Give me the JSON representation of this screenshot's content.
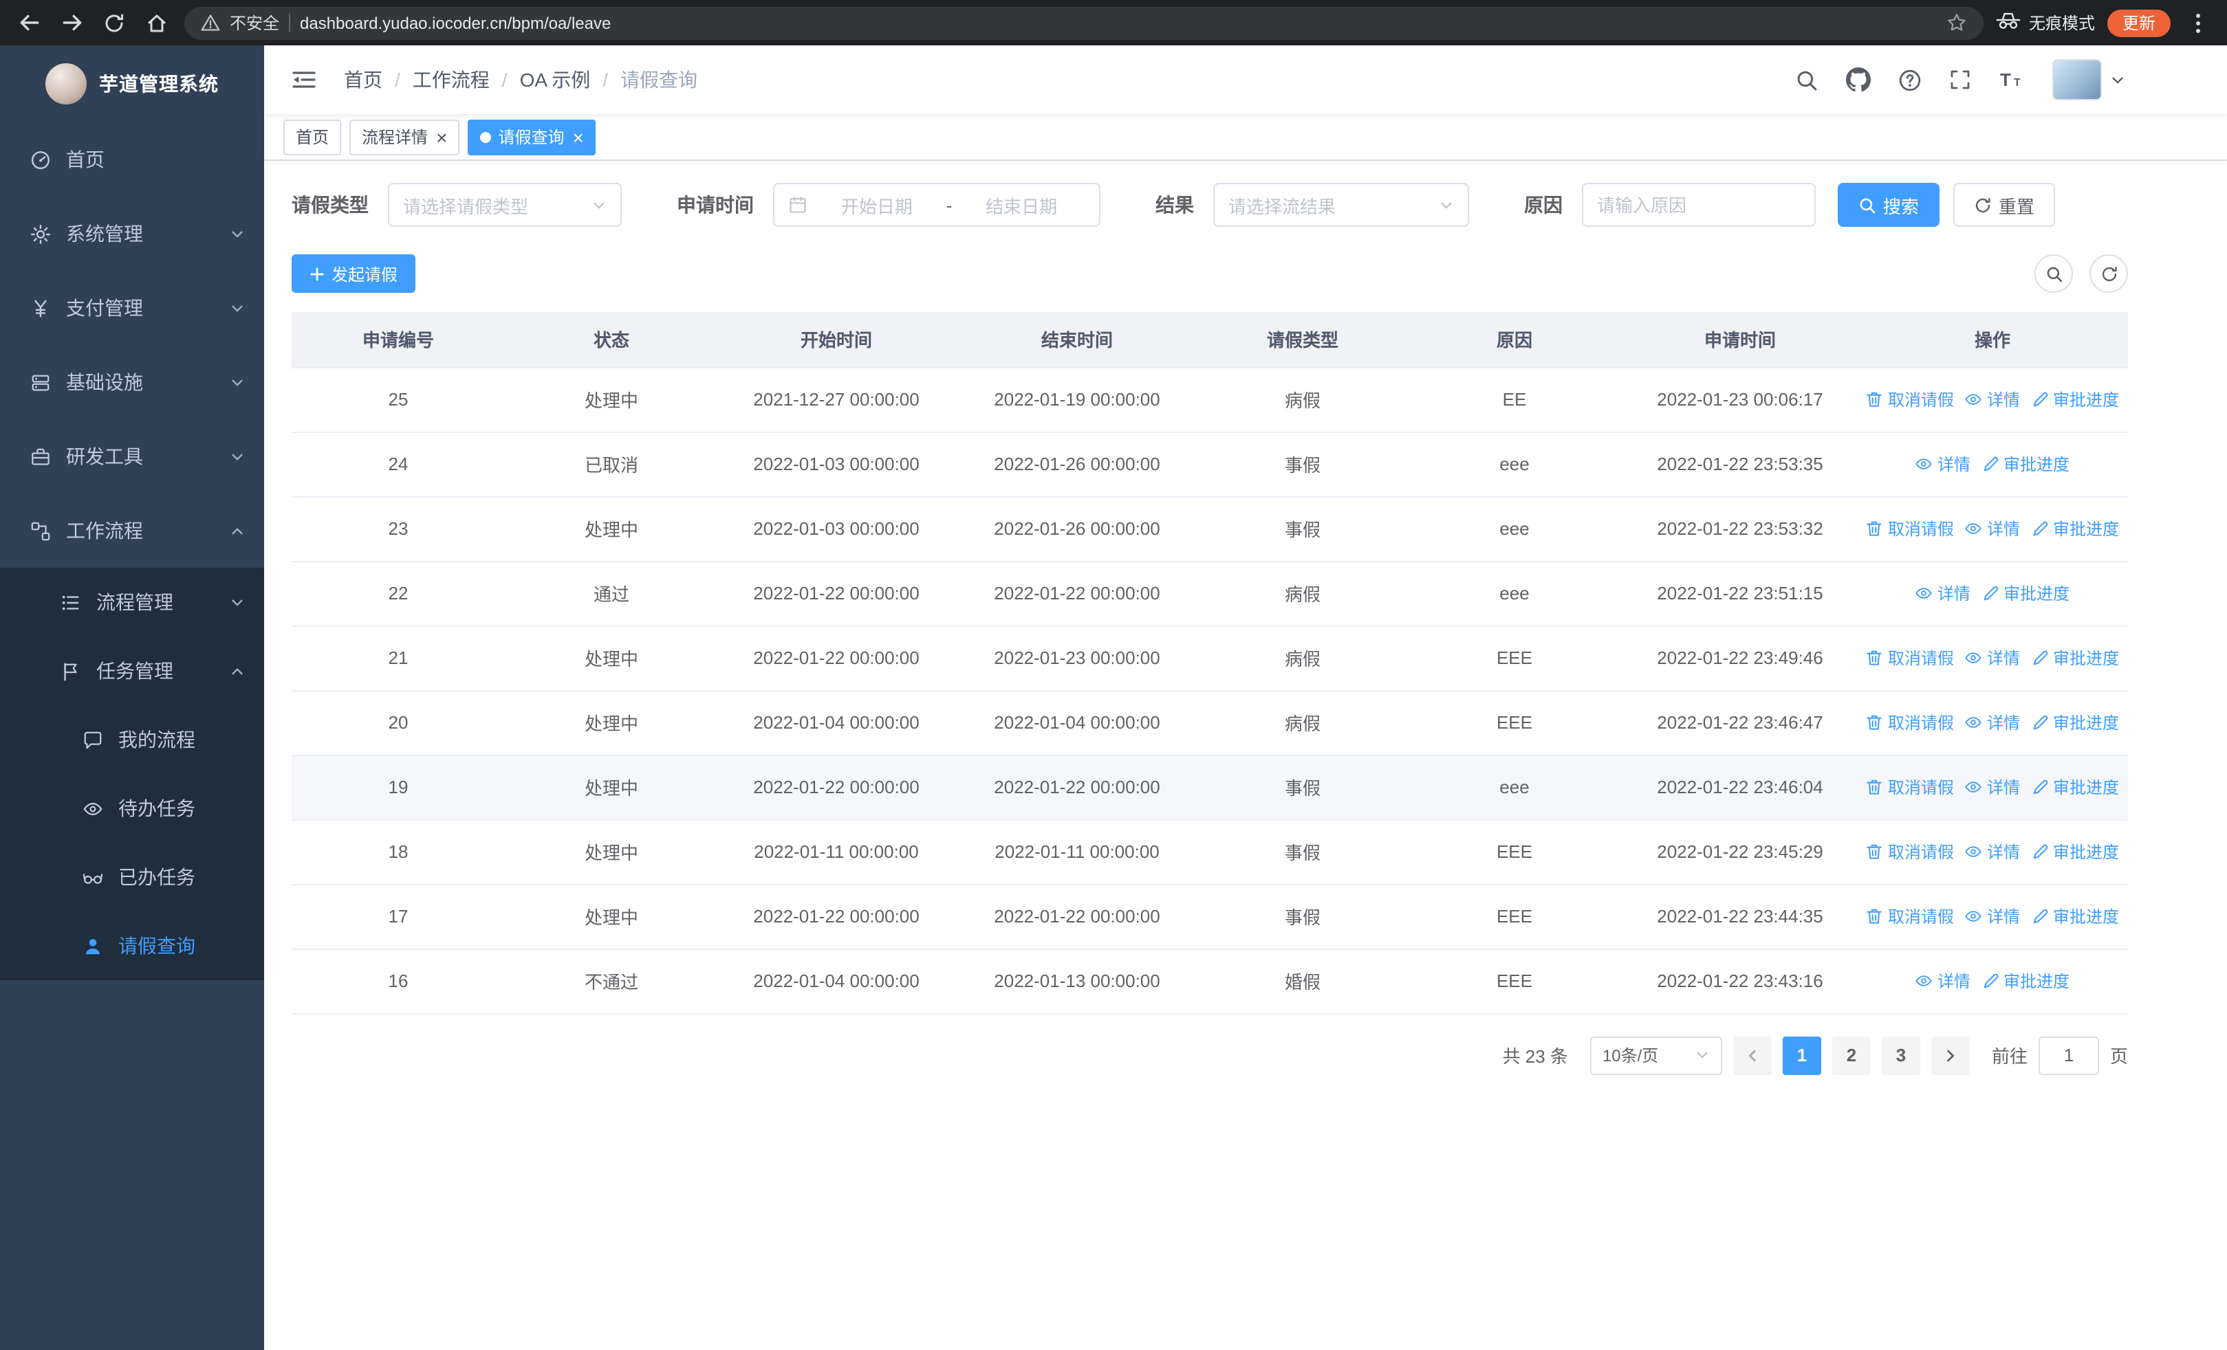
{
  "colors": {
    "primary": "#409eff",
    "sidebar_bg": "#304156",
    "sidebar_submenu_bg": "#1f2d3d",
    "active_tab_bg": "#409eff",
    "update_button_bg": "#ed6337"
  },
  "browser": {
    "security_label": "不安全",
    "url": "dashboard.yudao.iocoder.cn/bpm/oa/leave",
    "incognito_label": "无痕模式",
    "update_label": "更新"
  },
  "sidebar": {
    "logo_title": "芋道管理系统",
    "items": [
      {
        "name": "home",
        "label": "首页",
        "icon": "dashboard-icon",
        "level": 1
      },
      {
        "name": "system-management",
        "label": "系统管理",
        "icon": "gear-icon",
        "level": 1,
        "arrow": "down"
      },
      {
        "name": "payment-management",
        "label": "支付管理",
        "icon": "yen-icon",
        "level": 1,
        "arrow": "down"
      },
      {
        "name": "infrastructure",
        "label": "基础设施",
        "icon": "server-icon",
        "level": 1,
        "arrow": "down"
      },
      {
        "name": "dev-tools",
        "label": "研发工具",
        "icon": "toolbox-icon",
        "level": 1,
        "arrow": "down"
      },
      {
        "name": "workflow",
        "label": "工作流程",
        "icon": "workflow-icon",
        "level": 1,
        "arrow": "up"
      },
      {
        "name": "process-management",
        "label": "流程管理",
        "icon": "list-icon",
        "level": 2,
        "arrow": "down"
      },
      {
        "name": "task-management",
        "label": "任务管理",
        "icon": "flag-icon",
        "level": 2,
        "arrow": "up"
      },
      {
        "name": "my-process",
        "label": "我的流程",
        "icon": "chat-icon",
        "level": 3
      },
      {
        "name": "todo-tasks",
        "label": "待办任务",
        "icon": "eye-icon",
        "level": 3
      },
      {
        "name": "done-tasks",
        "label": "已办任务",
        "icon": "glasses-icon",
        "level": 3
      },
      {
        "name": "leave-query",
        "label": "请假查询",
        "icon": "user-icon",
        "level": 3,
        "active": true
      }
    ]
  },
  "header": {
    "breadcrumb": [
      "首页",
      "工作流程",
      "OA 示例",
      "请假查询"
    ]
  },
  "tabs": [
    {
      "name": "home",
      "label": "首页"
    },
    {
      "name": "process-detail",
      "label": "流程详情",
      "closable": true
    },
    {
      "name": "leave-query",
      "label": "请假查询",
      "closable": true,
      "active": true
    }
  ],
  "filters": {
    "leave_type_label": "请假类型",
    "leave_type_placeholder": "请选择请假类型",
    "apply_time_label": "申请时间",
    "start_date_placeholder": "开始日期",
    "range_separator": "-",
    "end_date_placeholder": "结束日期",
    "result_label": "结果",
    "result_placeholder": "请选择流结果",
    "reason_label": "原因",
    "reason_placeholder": "请输入原因",
    "search_label": "搜索",
    "reset_label": "重置"
  },
  "toolbar": {
    "create_label": "发起请假"
  },
  "table": {
    "columns": [
      {
        "key": "id",
        "label": "申请编号"
      },
      {
        "key": "status",
        "label": "状态"
      },
      {
        "key": "start",
        "label": "开始时间"
      },
      {
        "key": "end",
        "label": "结束时间"
      },
      {
        "key": "type",
        "label": "请假类型"
      },
      {
        "key": "reason",
        "label": "原因"
      },
      {
        "key": "applied",
        "label": "申请时间"
      },
      {
        "key": "actions",
        "label": "操作"
      }
    ],
    "action_labels": {
      "cancel": "取消请假",
      "detail": "详情",
      "progress": "审批进度"
    },
    "rows": [
      {
        "id": "25",
        "status": "处理中",
        "start": "2021-12-27 00:00:00",
        "end": "2022-01-19 00:00:00",
        "type": "病假",
        "reason": "EE",
        "applied": "2022-01-23 00:06:17",
        "actions": [
          "cancel",
          "detail",
          "progress"
        ]
      },
      {
        "id": "24",
        "status": "已取消",
        "start": "2022-01-03 00:00:00",
        "end": "2022-01-26 00:00:00",
        "type": "事假",
        "reason": "eee",
        "applied": "2022-01-22 23:53:35",
        "actions": [
          "detail",
          "progress"
        ]
      },
      {
        "id": "23",
        "status": "处理中",
        "start": "2022-01-03 00:00:00",
        "end": "2022-01-26 00:00:00",
        "type": "事假",
        "reason": "eee",
        "applied": "2022-01-22 23:53:32",
        "actions": [
          "cancel",
          "detail",
          "progress"
        ]
      },
      {
        "id": "22",
        "status": "通过",
        "start": "2022-01-22 00:00:00",
        "end": "2022-01-22 00:00:00",
        "type": "病假",
        "reason": "eee",
        "applied": "2022-01-22 23:51:15",
        "actions": [
          "detail",
          "progress"
        ]
      },
      {
        "id": "21",
        "status": "处理中",
        "start": "2022-01-22 00:00:00",
        "end": "2022-01-23 00:00:00",
        "type": "病假",
        "reason": "EEE",
        "applied": "2022-01-22 23:49:46",
        "actions": [
          "cancel",
          "detail",
          "progress"
        ]
      },
      {
        "id": "20",
        "status": "处理中",
        "start": "2022-01-04 00:00:00",
        "end": "2022-01-04 00:00:00",
        "type": "病假",
        "reason": "EEE",
        "applied": "2022-01-22 23:46:47",
        "actions": [
          "cancel",
          "detail",
          "progress"
        ]
      },
      {
        "id": "19",
        "status": "处理中",
        "start": "2022-01-22 00:00:00",
        "end": "2022-01-22 00:00:00",
        "type": "事假",
        "reason": "eee",
        "applied": "2022-01-22 23:46:04",
        "actions": [
          "cancel",
          "detail",
          "progress"
        ],
        "hover": true
      },
      {
        "id": "18",
        "status": "处理中",
        "start": "2022-01-11 00:00:00",
        "end": "2022-01-11 00:00:00",
        "type": "事假",
        "reason": "EEE",
        "applied": "2022-01-22 23:45:29",
        "actions": [
          "cancel",
          "detail",
          "progress"
        ]
      },
      {
        "id": "17",
        "status": "处理中",
        "start": "2022-01-22 00:00:00",
        "end": "2022-01-22 00:00:00",
        "type": "事假",
        "reason": "EEE",
        "applied": "2022-01-22 23:44:35",
        "actions": [
          "cancel",
          "detail",
          "progress"
        ]
      },
      {
        "id": "16",
        "status": "不通过",
        "start": "2022-01-04 00:00:00",
        "end": "2022-01-13 00:00:00",
        "type": "婚假",
        "reason": "EEE",
        "applied": "2022-01-22 23:43:16",
        "actions": [
          "detail",
          "progress"
        ]
      }
    ]
  },
  "pagination": {
    "total_text": "共 23 条",
    "page_size_value": "10条/页",
    "pages": [
      "1",
      "2",
      "3"
    ],
    "active_page": "1",
    "goto_label": "前往",
    "goto_value": "1",
    "goto_suffix": "页"
  }
}
